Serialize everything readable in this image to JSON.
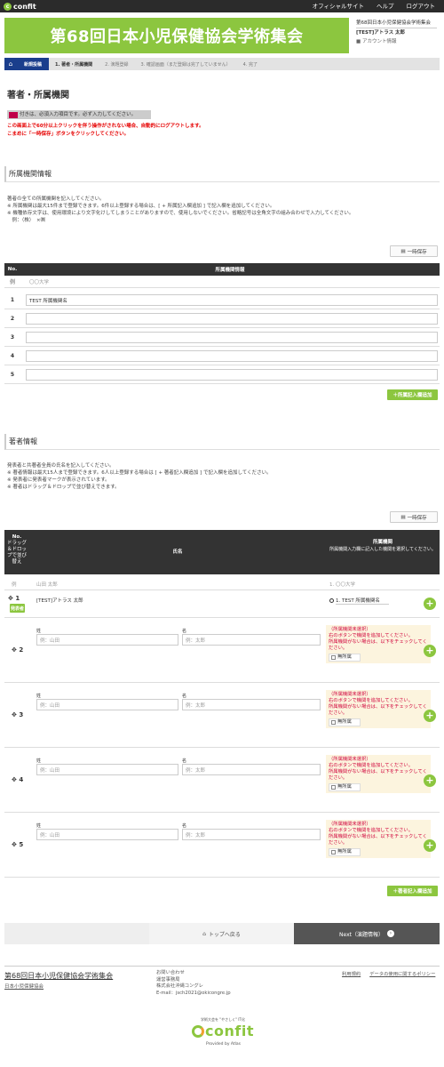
{
  "header": {
    "logo_text": "confit",
    "links": [
      "オフィシャルサイト",
      "ヘルプ",
      "ログアウト"
    ]
  },
  "banner": {
    "title": "第68回日本小児保健協会学術集会"
  },
  "user": {
    "event": "第68回日本小児保健協会学術集会",
    "name": "[TEST]アトラス 太郎",
    "account": "アカウント情報"
  },
  "steps": [
    "新規投稿",
    "1. 著者・所属機関",
    "2. 演題登録",
    "3. 確認画面（まだ登録は完了していません）",
    "4. 完了"
  ],
  "page_title": "著者・所属機関",
  "required_notice": "付きは、必須入力項目です。必ず入力してください。",
  "warnings": [
    "この画面上で60分以上クリックを伴う操作がされない場合、自動的にログアウトします。",
    "こまめに「一時保存」ボタンをクリックしてください。"
  ],
  "affiliation": {
    "section_title": "所属機関情報",
    "desc": [
      "著者の全ての所属機関を記入してください。",
      "※ 所属機関は最大15件まで登録できます。6件以上登録する場合は、[ + 所属記入欄追加 ] で記入欄を追加してください。",
      "※ 機種依存文字は、使用環境により文字化けしてしまうことがありますので、使用しないでください。省略記号は全角文字の組み合わせで入力してください。",
      "　例：（株）　×㈱"
    ],
    "save_label": "一時保存",
    "col_no": "No.",
    "col_info": "所属機関情報",
    "example_no": "例",
    "example_value": "〇〇大学",
    "rows": [
      {
        "no": "1",
        "value": "TEST 所属機関名"
      },
      {
        "no": "2",
        "value": ""
      },
      {
        "no": "3",
        "value": ""
      },
      {
        "no": "4",
        "value": ""
      },
      {
        "no": "5",
        "value": ""
      }
    ],
    "add_label": "＋所属記入欄追加"
  },
  "authors": {
    "section_title": "著者情報",
    "desc": [
      "発表者と共著者全員の氏名を記入してください。",
      "※ 著者情報は最大15人まで登録できます。6人以上登録する場合は [ + 著者記入欄追加 ] で記入欄を追加してください。",
      "※ 発表者に発表者マークが表示されています。",
      "※ 著者はドラッグ＆ドロップで並び替えできます。"
    ],
    "save_label": "一時保存",
    "col_no": "No.\nドラッグ＆ドロップで並び替え",
    "col_no_a": "No.",
    "col_no_b": "ドラッグ",
    "col_no_c": "＆ドロッ",
    "col_no_d": "プで並び",
    "col_no_e": "替え",
    "col_name": "氏名",
    "col_aff": "所属機関",
    "col_aff_sub": "所属機関入力欄に記入した機関を選択してください。",
    "example_no": "例",
    "example_name": "山田 太郎",
    "example_aff": "1. 〇〇大学",
    "presenter_badge": "発表者",
    "first": {
      "no": "1",
      "name": "[TEST]アトラス 太郎",
      "aff": "1. TEST 所属機関名"
    },
    "rows": [
      {
        "no": "2",
        "sei_label": "姓",
        "mei_label": "名",
        "sei_ph": "例：山田",
        "mei_ph": "例：太郎"
      },
      {
        "no": "3",
        "sei_label": "姓",
        "mei_label": "名",
        "sei_ph": "例：山田",
        "mei_ph": "例：太郎"
      },
      {
        "no": "4",
        "sei_label": "姓",
        "mei_label": "名",
        "sei_ph": "例：山田",
        "mei_ph": "例：太郎"
      },
      {
        "no": "5",
        "sei_label": "姓",
        "mei_label": "名",
        "sei_ph": "例：山田",
        "mei_ph": "例：太郎"
      }
    ],
    "aff_help": [
      "（所属機関未選択）",
      "右のボタンで機関を追加してください。",
      "所属機関がない場合は、以下をチェックしてください。"
    ],
    "no_aff_label": "無所属",
    "add_label": "＋著者記入欄追加"
  },
  "nav": {
    "top_label": "トップへ戻る",
    "next_label": "Next（演題情報）"
  },
  "footer": {
    "title": "第68回日本小児保健協会学術集会",
    "org": "日本小児保健協会",
    "contact": [
      "お問い合わせ",
      "運営事務局",
      "株式会社沖縄コングレ",
      "E-mail：jsch2021@okicongre.jp"
    ],
    "links": [
      "利用規約",
      "データの使用に関するポリシー"
    ],
    "logo_tag": "学術大会を \"やさしく\" IT化",
    "logo": "confit",
    "provided": "Provided by Atlas"
  },
  "colors": {
    "accent": "#8cc63f",
    "nav": "#1a3e8c",
    "dark": "#333333",
    "warn": "#e60000"
  }
}
